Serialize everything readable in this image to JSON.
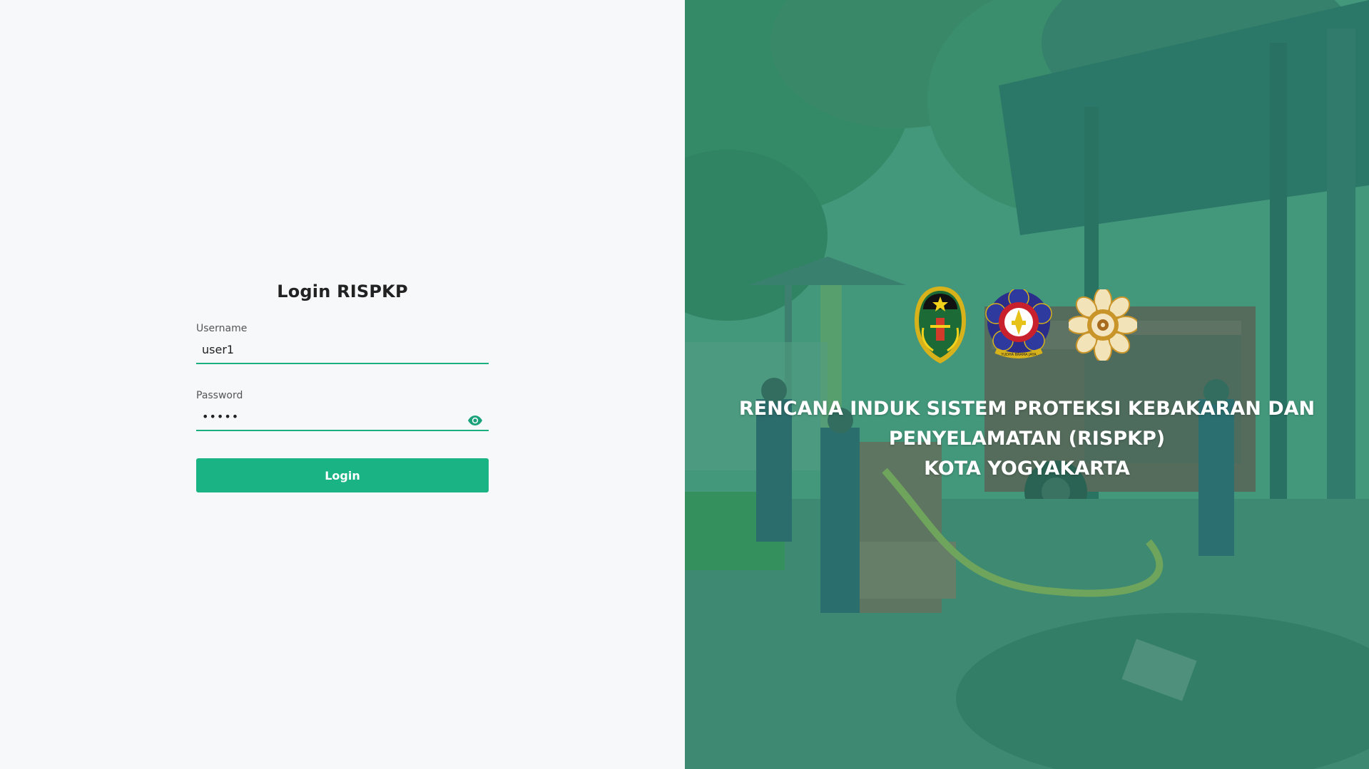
{
  "login": {
    "title": "Login RISPKP",
    "username_label": "Username",
    "username_value": "user1",
    "password_label": "Password",
    "password_value": "•••••",
    "button_label": "Login"
  },
  "hero": {
    "line1": "RENCANA INDUK SISTEM PROTEKSI KEBAKARAN DAN",
    "line2": "PENYELAMATAN (RISPKP)",
    "line3": "KOTA YOGYAKARTA",
    "logos": [
      "kota-yogyakarta-emblem",
      "damkar-emblem",
      "ugm-emblem"
    ],
    "logo2_motto": "YUDHA BRAMA JAYA"
  },
  "colors": {
    "accent": "#1ab484",
    "underline": "#1aae80",
    "overlay": "#2a9673"
  },
  "icons": {
    "password_toggle": "eye-icon"
  }
}
